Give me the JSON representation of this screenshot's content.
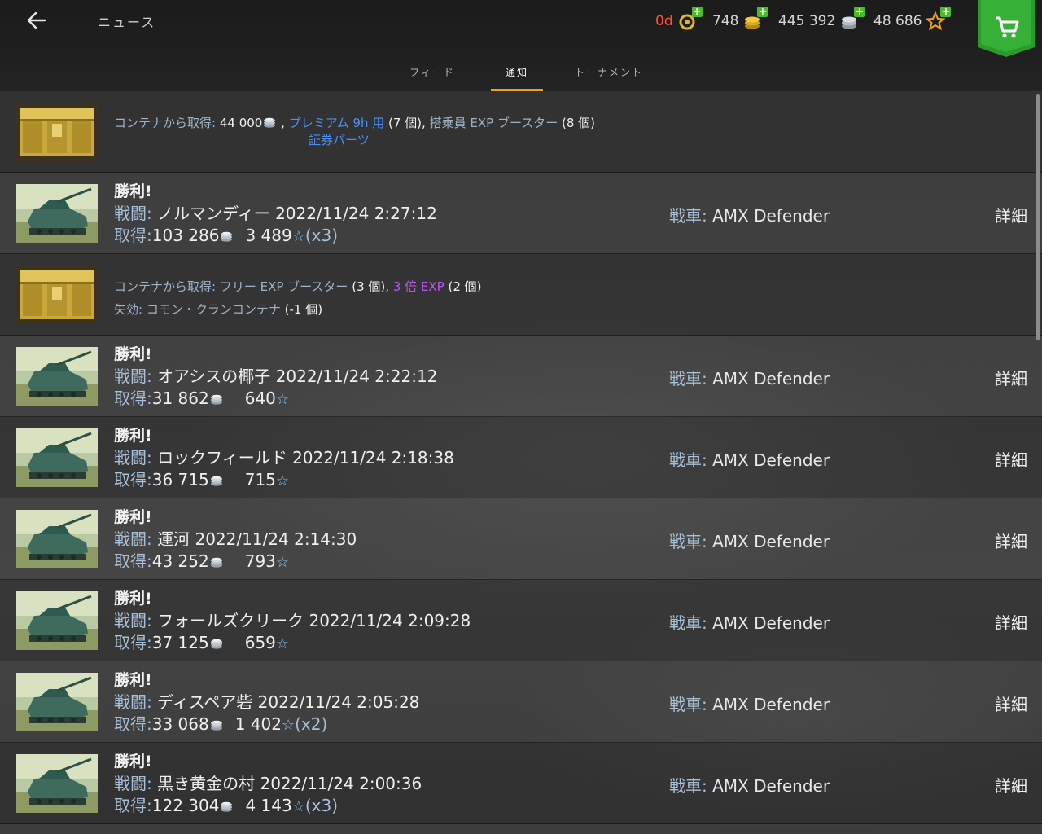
{
  "header": {
    "title": "ニュース",
    "currencies": {
      "premium": "0d",
      "gold": "748",
      "credits": "445 392",
      "free_xp": "48 686"
    }
  },
  "tabs": [
    {
      "label": "フィード"
    },
    {
      "label": "通知"
    },
    {
      "label": "トーナメント"
    }
  ],
  "containers": [
    {
      "prefix": "コンテナから取得:",
      "credits": "44 000",
      "sep1": ",",
      "item1": "プレミアム 9h 用",
      "item1_count": "(7 個)",
      "item1_line2": "証券パーツ",
      "sep2": ",",
      "item2": "搭乗員 EXP ブースター",
      "item2_count": "(8 個)"
    },
    {
      "prefix": "コンテナから取得:",
      "item1": "フリー EXP ブースター",
      "item1_count": "(3 個)",
      "sep": ",",
      "item2": "3 倍 EXP",
      "item2_count": "(2 個)",
      "lost_label": "失効:",
      "lost_item": "コモン・クランコンテナ",
      "lost_count": "(-1 個)"
    }
  ],
  "battles": [
    {
      "result": "勝利!",
      "battle_label": "戦闘:",
      "map": "ノルマンディー",
      "datetime": "2022/11/24 2:27:12",
      "earn_label": "取得:",
      "credits": "103 286",
      "xp": "3 489",
      "mult": "(x3)",
      "tank_label": "戦車:",
      "tank": "AMX Defender",
      "details": "詳細"
    },
    {
      "result": "勝利!",
      "battle_label": "戦闘:",
      "map": "オアシスの椰子",
      "datetime": "2022/11/24 2:22:12",
      "earn_label": "取得:",
      "credits": "31 862",
      "xp": "640",
      "mult": "",
      "tank_label": "戦車:",
      "tank": "AMX Defender",
      "details": "詳細"
    },
    {
      "result": "勝利!",
      "battle_label": "戦闘:",
      "map": "ロックフィールド",
      "datetime": "2022/11/24 2:18:38",
      "earn_label": "取得:",
      "credits": "36 715",
      "xp": "715",
      "mult": "",
      "tank_label": "戦車:",
      "tank": "AMX Defender",
      "details": "詳細"
    },
    {
      "result": "勝利!",
      "battle_label": "戦闘:",
      "map": "運河",
      "datetime": "2022/11/24 2:14:30",
      "earn_label": "取得:",
      "credits": "43 252",
      "xp": "793",
      "mult": "",
      "tank_label": "戦車:",
      "tank": "AMX Defender",
      "details": "詳細"
    },
    {
      "result": "勝利!",
      "battle_label": "戦闘:",
      "map": "フォールズクリーク",
      "datetime": "2022/11/24 2:09:28",
      "earn_label": "取得:",
      "credits": "37 125",
      "xp": "659",
      "mult": "",
      "tank_label": "戦車:",
      "tank": "AMX Defender",
      "details": "詳細"
    },
    {
      "result": "勝利!",
      "battle_label": "戦闘:",
      "map": "ディスペア砦",
      "datetime": "2022/11/24 2:05:28",
      "earn_label": "取得:",
      "credits": "33 068",
      "xp": "1 402",
      "mult": "(x2)",
      "tank_label": "戦車:",
      "tank": "AMX Defender",
      "details": "詳細"
    },
    {
      "result": "勝利!",
      "battle_label": "戦闘:",
      "map": "黒き黄金の村",
      "datetime": "2022/11/24 2:00:36",
      "earn_label": "取得:",
      "credits": "122 304",
      "xp": "4 143",
      "mult": "(x3)",
      "tank_label": "戦車:",
      "tank": "AMX Defender",
      "details": "詳細"
    }
  ],
  "colors": {
    "accent_tab": "#f0a020",
    "premium_red": "#ff4d3d",
    "plus_green": "#4dbb28",
    "link_blue": "#4f8ff2",
    "purple": "#b659e8",
    "label": "#a8c0d8"
  },
  "icons": [
    "back-arrow-icon",
    "premium-icon",
    "gold-icon",
    "credits-icon",
    "free-xp-icon",
    "plus-icon",
    "shop-cart-icon",
    "container-icon",
    "tank-thumbnail",
    "credit-coin-icon",
    "xp-star-icon"
  ]
}
